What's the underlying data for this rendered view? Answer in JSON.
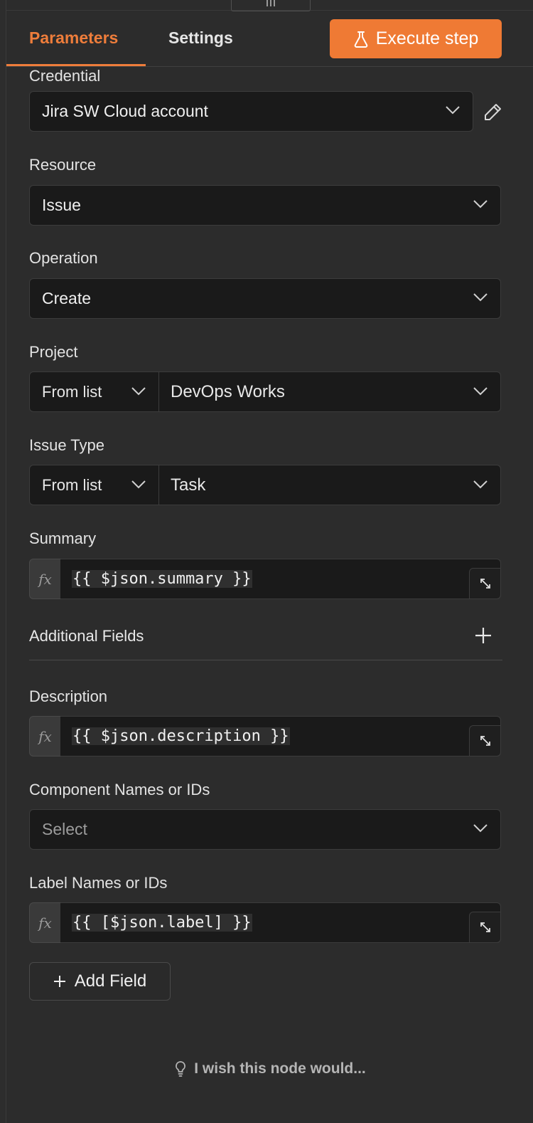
{
  "tabs": {
    "parameters": "Parameters",
    "settings": "Settings"
  },
  "execute_button": "Execute step",
  "credential": {
    "label": "Credential",
    "value": "Jira SW Cloud account"
  },
  "resource": {
    "label": "Resource",
    "value": "Issue"
  },
  "operation": {
    "label": "Operation",
    "value": "Create"
  },
  "project": {
    "label": "Project",
    "mode": "From list",
    "value": "DevOps Works"
  },
  "issue_type": {
    "label": "Issue Type",
    "mode": "From list",
    "value": "Task"
  },
  "summary": {
    "label": "Summary",
    "expression": "{{ $json.summary }}"
  },
  "additional_fields": {
    "label": "Additional Fields"
  },
  "description": {
    "label": "Description",
    "expression": "{{ $json.description }}"
  },
  "component_names": {
    "label": "Component Names or IDs",
    "placeholder": "Select"
  },
  "label_names": {
    "label": "Label Names or IDs",
    "expression": "{{ [$json.label] }}"
  },
  "add_field_button": "Add Field",
  "wish_link": "I wish this node would...",
  "fx_symbol": "fx",
  "colors": {
    "accent": "#ef7a34",
    "background": "#2c2c2c",
    "input_bg": "#1a1a1a"
  }
}
